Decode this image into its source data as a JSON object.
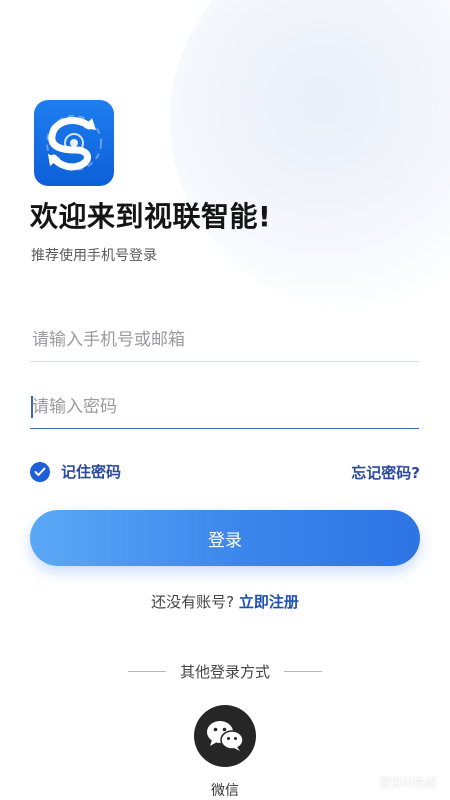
{
  "header": {
    "title": "欢迎来到视联智能!",
    "subtitle": "推荐使用手机号登录"
  },
  "form": {
    "phone_placeholder": "请输入手机号或邮箱",
    "password_placeholder": "请输入密码",
    "remember_label": "记住密码",
    "remember_checked": true,
    "forgot_label": "忘记密码?",
    "login_label": "登录"
  },
  "register": {
    "text": "还没有账号?",
    "link": "立即注册"
  },
  "other_login": {
    "label": "其他登录方式",
    "wechat_label": "微信"
  },
  "watermark": "豆包AI生成",
  "colors": {
    "accent": "#1f5fd6",
    "link": "#2b4aa0",
    "button_start": "#5ba8f6",
    "button_end": "#2d74e4",
    "logo": "#1e7ef0"
  },
  "icons": {
    "logo": "app-logo-icon",
    "check": "check-icon",
    "wechat": "wechat-icon"
  }
}
